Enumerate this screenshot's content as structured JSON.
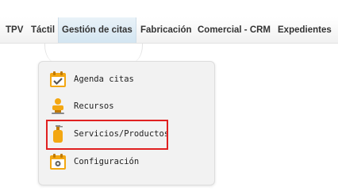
{
  "menubar": {
    "items": [
      {
        "label": "TPV"
      },
      {
        "label": "Táctil"
      },
      {
        "label": "Gestión de citas",
        "active": true
      },
      {
        "label": "Fabricación"
      },
      {
        "label": "Comercial - CRM"
      },
      {
        "label": "Expedientes"
      }
    ]
  },
  "dropdown": {
    "items": [
      {
        "label": "Agenda citas",
        "icon": "calendar-check-icon"
      },
      {
        "label": "Recursos",
        "icon": "person-resource-icon"
      },
      {
        "label": "Servicios/Productos",
        "icon": "bottle-product-icon",
        "highlighted": true
      },
      {
        "label": "Configuración",
        "icon": "calendar-gear-icon"
      }
    ]
  },
  "colors": {
    "highlight_border": "#e02020",
    "icon_orange": "#f3a712",
    "active_tab": "#d3e5f1"
  }
}
